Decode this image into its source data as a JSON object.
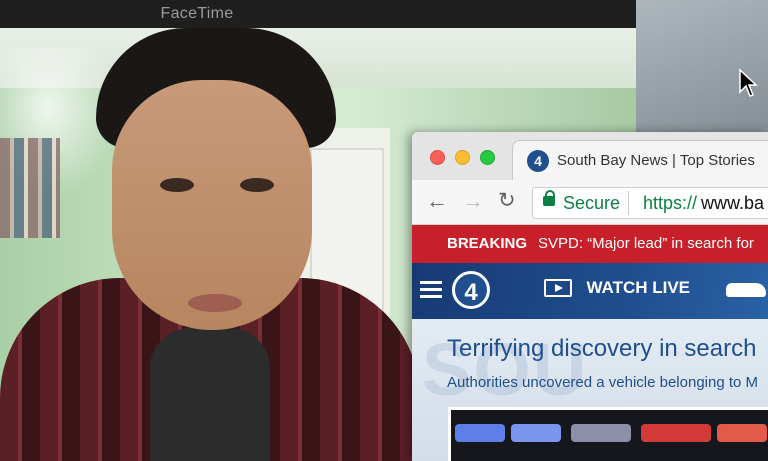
{
  "facetime": {
    "title": "FaceTime"
  },
  "browser": {
    "tab_title": "South Bay News | Top Stories",
    "tab_favicon_text": "4",
    "address": {
      "secure_label": "Secure",
      "scheme": "https://",
      "host": "www.ba"
    },
    "breaking": {
      "tag": "BREAKING",
      "text": "SVPD: “Major lead” in search for"
    },
    "site_nav": {
      "logo_text": "4",
      "watch_live_label": "WATCH LIVE"
    },
    "article": {
      "watermark": "SOU",
      "headline": "Terrifying discovery in search",
      "subhead": "Authorities uncovered a vehicle belonging to M"
    }
  },
  "colors": {
    "breaking_red": "#c8202a",
    "brand_blue": "#1f4f8d",
    "secure_green": "#0b8043"
  },
  "icons": [
    "back-icon",
    "forward-icon",
    "reload-icon",
    "lock-icon",
    "hamburger-icon",
    "play-icon",
    "car-icon",
    "mouse-cursor-icon"
  ]
}
